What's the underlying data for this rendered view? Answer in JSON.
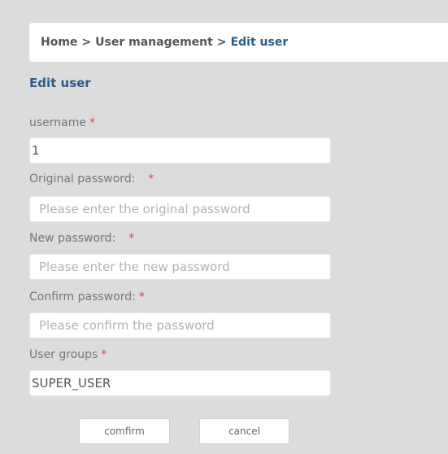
{
  "breadcrumb": {
    "home": "Home",
    "separator": ">",
    "section": "User management",
    "current": "Edit user"
  },
  "form": {
    "title": "Edit user",
    "required_mark": "*",
    "username": {
      "label": "username",
      "value": "1"
    },
    "original_password": {
      "label": "Original password:",
      "placeholder": "Please enter the original password"
    },
    "new_password": {
      "label": "New password:",
      "placeholder": "Please enter the new password"
    },
    "confirm_password": {
      "label": "Confirm password:",
      "placeholder": "Please confirm the password"
    },
    "user_groups": {
      "label": "User groups",
      "value": "SUPER_USER"
    }
  },
  "actions": {
    "confirm_label": "comfirm",
    "cancel_label": "cancel"
  },
  "colors": {
    "page_background": "#dcdcdc",
    "accent": "#2a5d8a",
    "required": "#e04040",
    "placeholder": "#b2b2b2"
  }
}
